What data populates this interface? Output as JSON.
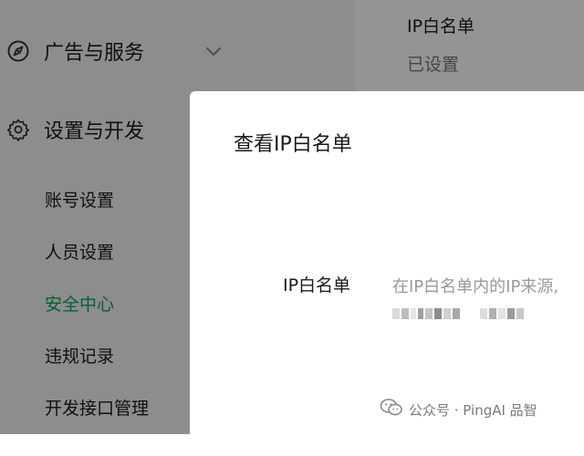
{
  "sidebar": {
    "sections": [
      {
        "label": "广告与服务",
        "icon": "compass-icon",
        "chevron": "chevron-down-icon"
      },
      {
        "label": "设置与开发",
        "icon": "gear-icon"
      }
    ],
    "items": [
      {
        "label": "账号设置",
        "active": false
      },
      {
        "label": "人员设置",
        "active": false
      },
      {
        "label": "安全中心",
        "active": true
      },
      {
        "label": "违规记录",
        "active": false
      },
      {
        "label": "开发接口管理",
        "active": false
      }
    ],
    "active_color": "#07a35a"
  },
  "background_panel": {
    "ip_title": "IP白名单",
    "ip_status": "已设置"
  },
  "dialog": {
    "title": "查看IP白名单",
    "field_label": "IP白名单",
    "field_description": "在IP白名单内的IP来源,"
  },
  "watermark": {
    "text": "公众号 · PingAI 品智",
    "icon": "wechat-icon"
  }
}
